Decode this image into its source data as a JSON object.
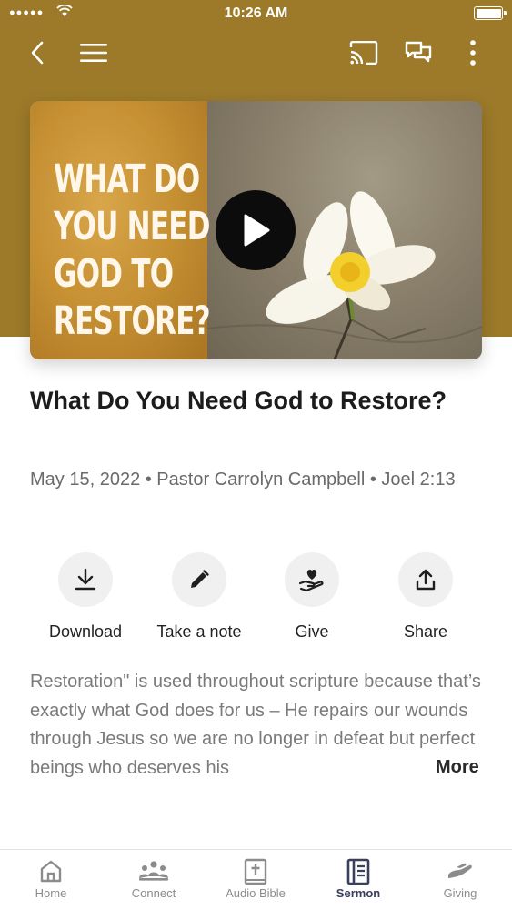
{
  "status_bar": {
    "time": "10:26 AM",
    "signal": "●●●●●"
  },
  "nav": {
    "back_icon": "chevron-left-icon",
    "menu_icon": "hamburger-menu-icon",
    "cast_icon": "cast-icon",
    "chat_icon": "chat-bubbles-icon",
    "more_icon": "more-vertical-icon"
  },
  "video": {
    "thumbnail_text": "WHAT DO YOU NEED GOD TO RESTORE?",
    "play_icon": "play-icon"
  },
  "sermon": {
    "title": "What Do You Need God to Restore?",
    "meta": "May 15, 2022 • Pastor Carrolyn Campbell • Joel 2:13"
  },
  "actions": [
    {
      "label": "Download",
      "icon": "download-icon"
    },
    {
      "label": "Take a note",
      "icon": "pencil-icon"
    },
    {
      "label": "Give",
      "icon": "heart-hand-icon"
    },
    {
      "label": "Share",
      "icon": "share-icon"
    }
  ],
  "description": {
    "text": "Restoration\" is used throughout scripture because that’s exactly what God does for us – He repairs our wounds through Jesus so we are no longer in defeat but perfect beings who deserves his",
    "more_label": "More"
  },
  "tabs": [
    {
      "label": "Home",
      "icon": "home-icon",
      "active": false
    },
    {
      "label": "Connect",
      "icon": "people-icon",
      "active": false
    },
    {
      "label": "Audio Bible",
      "icon": "bible-icon",
      "active": false
    },
    {
      "label": "Sermon",
      "icon": "book-icon",
      "active": true
    },
    {
      "label": "Giving",
      "icon": "giving-hand-icon",
      "active": false
    }
  ],
  "colors": {
    "header": "#9c7a2a",
    "active_tab": "#3a3f5c",
    "inactive_tab": "#8c8c8c"
  }
}
